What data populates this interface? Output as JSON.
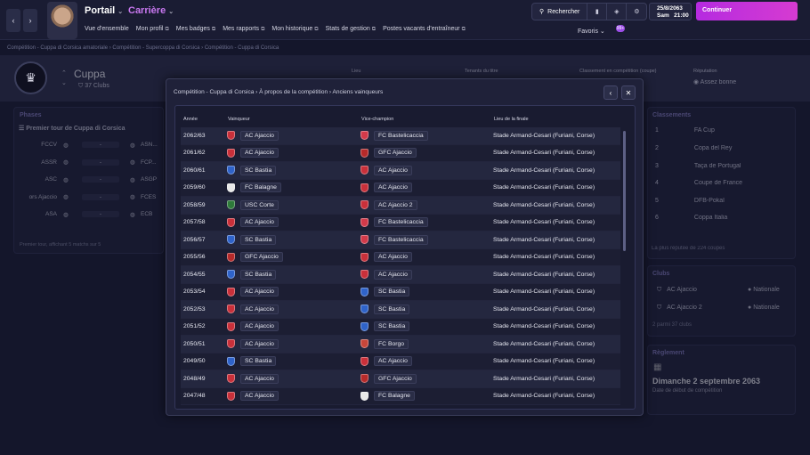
{
  "topbar": {
    "portail": "Portail",
    "carriere": "Carrière",
    "menu": [
      "Vue d'ensemble",
      "Mon profil",
      "Mes badges",
      "Mes rapports",
      "Mon historique",
      "Stats de gestion",
      "Postes vacants d'entraîneur"
    ],
    "search_label": "Rechercher",
    "date_line1": "25/8/2063",
    "date_line2_day": "Sam",
    "date_line2_time": "21:00",
    "continue_label": "Continuer",
    "favoris_label": "Favoris",
    "badge_count": "99+"
  },
  "breadcrumb": [
    "Compétition - Cuppa di Corsica amatoriale",
    "Compétition - Supercoppa di Corsica",
    "Compétition - Cuppa di Corsica"
  ],
  "competition": {
    "name": "Cuppa",
    "clubs": "37 Clubs",
    "stats": [
      "Lieu",
      "Tenants du titre",
      "Classement en compétition (coupe)",
      "Réputation"
    ],
    "reputation_value": "Assez bonne"
  },
  "phases": {
    "title": "Phases",
    "round": "Premier tour de Cuppa di Corsica",
    "matches": [
      {
        "home": "FCCV",
        "away": "ASN..."
      },
      {
        "home": "ASSR",
        "away": "FCP..."
      },
      {
        "home": "ASC",
        "away": "ASGP"
      },
      {
        "home": "ors Ajaccio",
        "away": "FCES"
      },
      {
        "home": "ASA",
        "away": "ECB"
      }
    ],
    "score_placeholder": "-",
    "footer": "Premier tour, affichant 5 matchs sur 5"
  },
  "classements": {
    "title": "Classements",
    "items": [
      {
        "rank": "1",
        "name": "FA Cup"
      },
      {
        "rank": "2",
        "name": "Copa del Rey"
      },
      {
        "rank": "3",
        "name": "Taça de Portugal"
      },
      {
        "rank": "4",
        "name": "Coupe de France"
      },
      {
        "rank": "5",
        "name": "DFB-Pokal"
      },
      {
        "rank": "6",
        "name": "Coppa Italia"
      }
    ],
    "footer": "La plus réputée de 224 coupes"
  },
  "clubs_panel": {
    "title": "Clubs",
    "items": [
      {
        "name": "AC Ajaccio",
        "rep": "Nationale"
      },
      {
        "name": "AC Ajaccio 2",
        "rep": "Nationale"
      }
    ],
    "footer": "2 parmi 37 clubs"
  },
  "reglement": {
    "title": "Règlement",
    "date": "Dimanche 2 septembre 2063",
    "caption": "Date de début de compétition"
  },
  "modal": {
    "crumb": [
      "Compétition - Cuppa di Corsica",
      "À propos de la compétition",
      "Anciens vainqueurs"
    ],
    "headers": {
      "year": "Année",
      "winner": "Vainqueur",
      "runner": "Vice-champion",
      "venue": "Lieu de la finale"
    },
    "rows": [
      {
        "year": "2062/63",
        "winner": "AC Ajaccio",
        "runner": "FC Bastelicaccia",
        "venue": "Stade Armand-Cesari (Furiani, Corse)"
      },
      {
        "year": "2061/62",
        "winner": "AC Ajaccio",
        "runner": "GFC Ajaccio",
        "venue": "Stade Armand-Cesari (Furiani, Corse)"
      },
      {
        "year": "2060/61",
        "winner": "SC Bastia",
        "runner": "AC Ajaccio",
        "venue": "Stade Armand-Cesari (Furiani, Corse)"
      },
      {
        "year": "2059/60",
        "winner": "FC Balagne",
        "runner": "AC Ajaccio",
        "venue": "Stade Armand-Cesari (Furiani, Corse)"
      },
      {
        "year": "2058/59",
        "winner": "USC Corte",
        "runner": "AC Ajaccio 2",
        "venue": "Stade Armand-Cesari (Furiani, Corse)"
      },
      {
        "year": "2057/58",
        "winner": "AC Ajaccio",
        "runner": "FC Bastelicaccia",
        "venue": "Stade Armand-Cesari (Furiani, Corse)"
      },
      {
        "year": "2056/57",
        "winner": "SC Bastia",
        "runner": "FC Bastelicaccia",
        "venue": "Stade Armand-Cesari (Furiani, Corse)"
      },
      {
        "year": "2055/56",
        "winner": "GFC Ajaccio",
        "runner": "AC Ajaccio",
        "venue": "Stade Armand-Cesari (Furiani, Corse)"
      },
      {
        "year": "2054/55",
        "winner": "SC Bastia",
        "runner": "AC Ajaccio",
        "venue": "Stade Armand-Cesari (Furiani, Corse)"
      },
      {
        "year": "2053/54",
        "winner": "AC Ajaccio",
        "runner": "SC Bastia",
        "venue": "Stade Armand-Cesari (Furiani, Corse)"
      },
      {
        "year": "2052/53",
        "winner": "AC Ajaccio",
        "runner": "SC Bastia",
        "venue": "Stade Armand-Cesari (Furiani, Corse)"
      },
      {
        "year": "2051/52",
        "winner": "AC Ajaccio",
        "runner": "SC Bastia",
        "venue": "Stade Armand-Cesari (Furiani, Corse)"
      },
      {
        "year": "2050/51",
        "winner": "AC Ajaccio",
        "runner": "FC Borgo",
        "venue": "Stade Armand-Cesari (Furiani, Corse)"
      },
      {
        "year": "2049/50",
        "winner": "SC Bastia",
        "runner": "AC Ajaccio",
        "venue": "Stade Armand-Cesari (Furiani, Corse)"
      },
      {
        "year": "2048/49",
        "winner": "AC Ajaccio",
        "runner": "GFC Ajaccio",
        "venue": "Stade Armand-Cesari (Furiani, Corse)"
      },
      {
        "year": "2047/48",
        "winner": "AC Ajaccio",
        "runner": "FC Balagne",
        "venue": "Stade Armand-Cesari (Furiani, Corse)"
      }
    ]
  },
  "colors": {
    "AC Ajaccio": "#c9303a",
    "SC Bastia": "#2f63c9",
    "FC Balagne": "#e8e8e8",
    "USC Corte": "#2e7a3a",
    "GFC Ajaccio": "#b52a2a",
    "FC Bastelicaccia": "#d23a4a",
    "AC Ajaccio 2": "#c9303a",
    "FC Borgo": "#c7463a"
  }
}
